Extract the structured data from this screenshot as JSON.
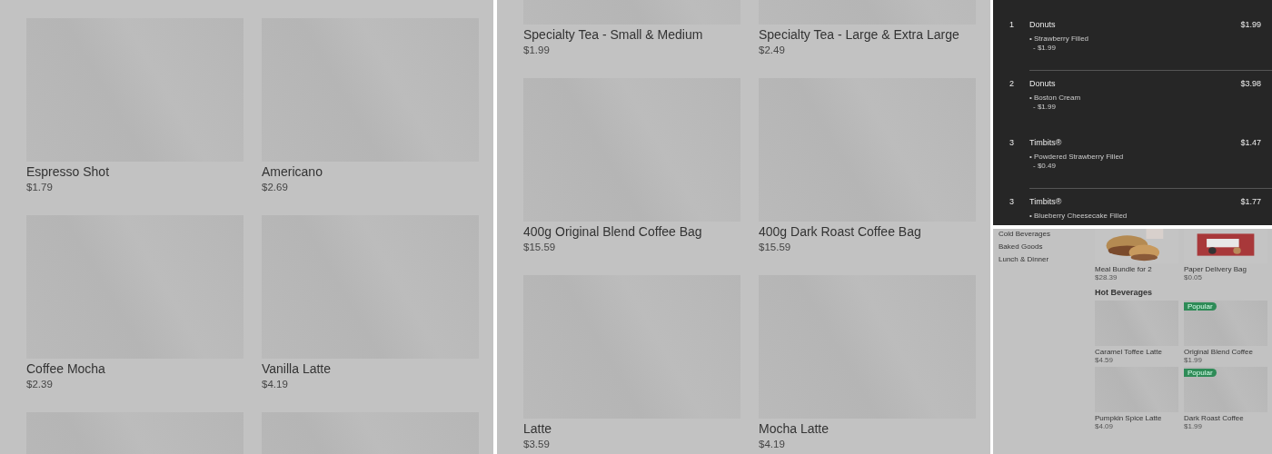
{
  "panels": [
    {
      "kind": "menu_grid",
      "cards": [
        {
          "kind": "product",
          "name": "Espresso Shot",
          "price": "$1.79"
        },
        {
          "kind": "product",
          "name": "Americano",
          "price": "$2.69"
        },
        {
          "kind": "product",
          "name": "Coffee Mocha",
          "price": "$2.39"
        },
        {
          "kind": "product",
          "name": "Vanilla Latte",
          "price": "$4.19"
        },
        {
          "kind": "image_only"
        },
        {
          "kind": "image_only"
        }
      ]
    },
    {
      "kind": "menu_grid",
      "cards": [
        {
          "kind": "product",
          "name": "Specialty Tea - Small & Medium",
          "price": "$1.99"
        },
        {
          "kind": "product",
          "name": "Specialty Tea - Large & Extra Large",
          "price": "$2.49"
        },
        {
          "kind": "product",
          "name": "400g Original Blend Coffee Bag",
          "price": "$15.59"
        },
        {
          "kind": "product",
          "name": "400g Dark Roast Coffee Bag",
          "price": "$15.59"
        },
        {
          "kind": "product",
          "name": "Latte",
          "price": "$3.59"
        },
        {
          "kind": "product",
          "name": "Mocha Latte",
          "price": "$4.19"
        }
      ]
    }
  ],
  "order": {
    "items": [
      {
        "qty": "1",
        "name": "Donuts",
        "price": "$1.99",
        "option": "• Strawberry Filled",
        "option_price": "- $1.99",
        "divider": true
      },
      {
        "qty": "2",
        "name": "Donuts",
        "price": "$3.98",
        "option": "• Boston Cream",
        "option_price": "- $1.99",
        "divider": false
      },
      {
        "qty": "3",
        "name": "Timbits®",
        "price": "$1.47",
        "option": "• Powdered Strawberry Filled",
        "option_price": "- $0.49",
        "divider": true
      },
      {
        "qty": "3",
        "name": "Timbits®",
        "price": "$1.77",
        "option": "• Blueberry Cheesecake Filled"
      }
    ]
  },
  "store": {
    "categories": [
      "Cold Beverages",
      "Baked Goods",
      "Lunch & Dinner"
    ],
    "featured": [
      {
        "name": "Meal Bundle for 2",
        "price": "$28.39",
        "kind": "picture"
      },
      {
        "name": "Paper Delivery Bag",
        "price": "$0.05",
        "kind": "picture"
      }
    ],
    "section_title": "Hot Beverages",
    "cards": [
      {
        "name": "Caramel Toffee Latte",
        "price": "$4.59"
      },
      {
        "name": "Original Blend Coffee",
        "price": "$1.99",
        "badge": "Popular"
      },
      {
        "name": "Pumpkin Spice Latte",
        "price": "$4.09"
      },
      {
        "name": "Dark Roast Coffee",
        "price": "$1.99",
        "badge": "Popular"
      }
    ]
  }
}
